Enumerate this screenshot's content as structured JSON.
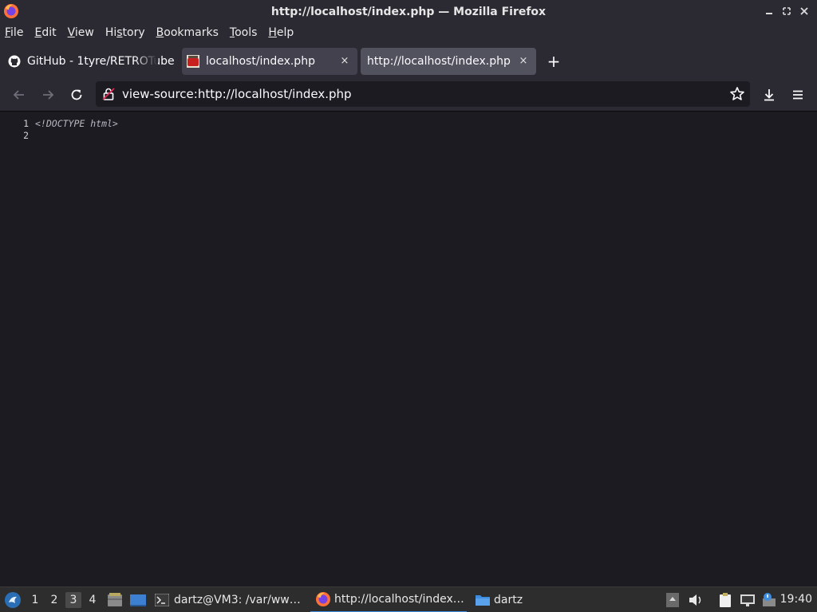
{
  "window": {
    "title": "http://localhost/index.php — Mozilla Firefox"
  },
  "menubar": {
    "items": [
      {
        "label": "File",
        "accel": "F",
        "rest": "ile"
      },
      {
        "label": "Edit",
        "accel": "E",
        "rest": "dit"
      },
      {
        "label": "View",
        "accel": "V",
        "rest": "iew"
      },
      {
        "label": "History",
        "pre": "Hi",
        "accel": "s",
        "rest": "tory"
      },
      {
        "label": "Bookmarks",
        "accel": "B",
        "rest": "ookmarks"
      },
      {
        "label": "Tools",
        "accel": "T",
        "rest": "ools"
      },
      {
        "label": "Help",
        "accel": "H",
        "rest": "elp"
      }
    ]
  },
  "tabs": [
    {
      "label": "GitHub - 1tyre/RETROTube",
      "icon": "github-icon",
      "selected": false
    },
    {
      "label": "localhost/index.php",
      "icon": "retrotube-favicon",
      "selected": false,
      "close": "×"
    },
    {
      "label": "http://localhost/index.php",
      "icon": "",
      "selected": true,
      "close": "×"
    }
  ],
  "new_tab_label": "+",
  "navbar": {
    "url": "view-source:http://localhost/index.php"
  },
  "source": {
    "lines": [
      {
        "num": "1",
        "code": "<!DOCTYPE html>"
      },
      {
        "num": "2",
        "code": ""
      }
    ]
  },
  "taskbar": {
    "workspaces": [
      "1",
      "2",
      "3",
      "4"
    ],
    "active_workspace": "3",
    "tasks": [
      {
        "label": "dartz@VM3: /var/ww…",
        "icon": "terminal-icon"
      },
      {
        "label": "http://localhost/index…",
        "icon": "firefox-icon",
        "active": true
      },
      {
        "label": "dartz",
        "icon": "folder-icon"
      }
    ],
    "clock": "19:40"
  },
  "colors": {
    "chrome": "#2b2a33",
    "content_bg": "#1c1b22",
    "selected_tab": "#52515e",
    "taskbar": "#2d2d2d",
    "accent": "#3d8ee0"
  }
}
